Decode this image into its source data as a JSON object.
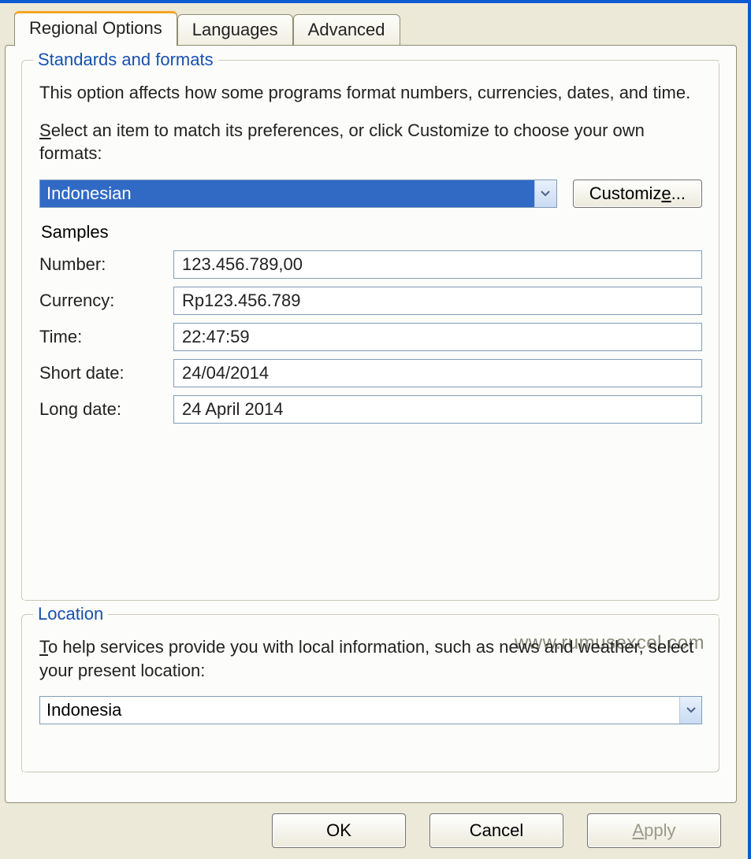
{
  "tabs": {
    "regional": "Regional Options",
    "languages": "Languages",
    "advanced": "Advanced"
  },
  "standards": {
    "title": "Standards and formats",
    "desc": "This option affects how some programs format numbers, currencies, dates, and time.",
    "select_prefix": "S",
    "select_text": "elect an item to match its preferences, or click Customize to choose your own formats:",
    "combo_value": "Indonesian",
    "customize_label": "Customiz",
    "customize_suffix": "e...",
    "customize_underline": "e",
    "samples_label": "Samples",
    "rows": {
      "number_label": "Number:",
      "number_value": "123.456.789,00",
      "currency_label": "Currency:",
      "currency_value": "Rp123.456.789",
      "time_label": "Time:",
      "time_value": "22:47:59",
      "shortdate_label": "Short date:",
      "shortdate_value": "24/04/2014",
      "longdate_label": "Long date:",
      "longdate_value": "24 April 2014"
    }
  },
  "watermark": "www.rumusexcel.com",
  "location": {
    "title": "Location",
    "desc_prefix": "T",
    "desc_text": "o help services provide you with local information, such as news and weather, select your present location:",
    "combo_value": "Indonesia"
  },
  "buttons": {
    "ok": "OK",
    "cancel": "Cancel",
    "apply_prefix": "A",
    "apply_rest": "pply"
  }
}
